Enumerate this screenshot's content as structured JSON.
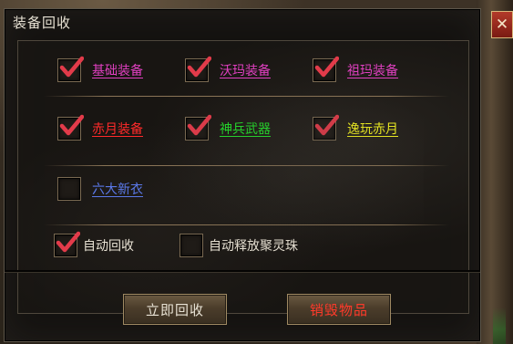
{
  "window": {
    "title": "装备回收",
    "close_glyph": "✕"
  },
  "row1": [
    {
      "label": "基础装备",
      "checked": true,
      "color": "#e040c0"
    },
    {
      "label": "沃玛装备",
      "checked": true,
      "color": "#e040c0"
    },
    {
      "label": "祖玛装备",
      "checked": true,
      "color": "#e040c0"
    }
  ],
  "row2": [
    {
      "label": "赤月装备",
      "checked": true,
      "color": "#ff2a2a"
    },
    {
      "label": "神兵武器",
      "checked": true,
      "color": "#22e02a"
    },
    {
      "label": "逸玩赤月",
      "checked": true,
      "color": "#f0f020"
    }
  ],
  "row3": [
    {
      "label": "六大新衣",
      "checked": false,
      "color": "#5a78e8"
    }
  ],
  "options": [
    {
      "label": "自动回收",
      "checked": true
    },
    {
      "label": "自动释放聚灵珠",
      "checked": false
    }
  ],
  "buttons": {
    "recycle_now": "立即回收",
    "destroy_items": "销毁物品",
    "recycle_now_color": "#e8e2d4",
    "destroy_items_color": "#ff3a2a"
  },
  "icons": {
    "check": "check-icon",
    "close": "close-icon"
  }
}
